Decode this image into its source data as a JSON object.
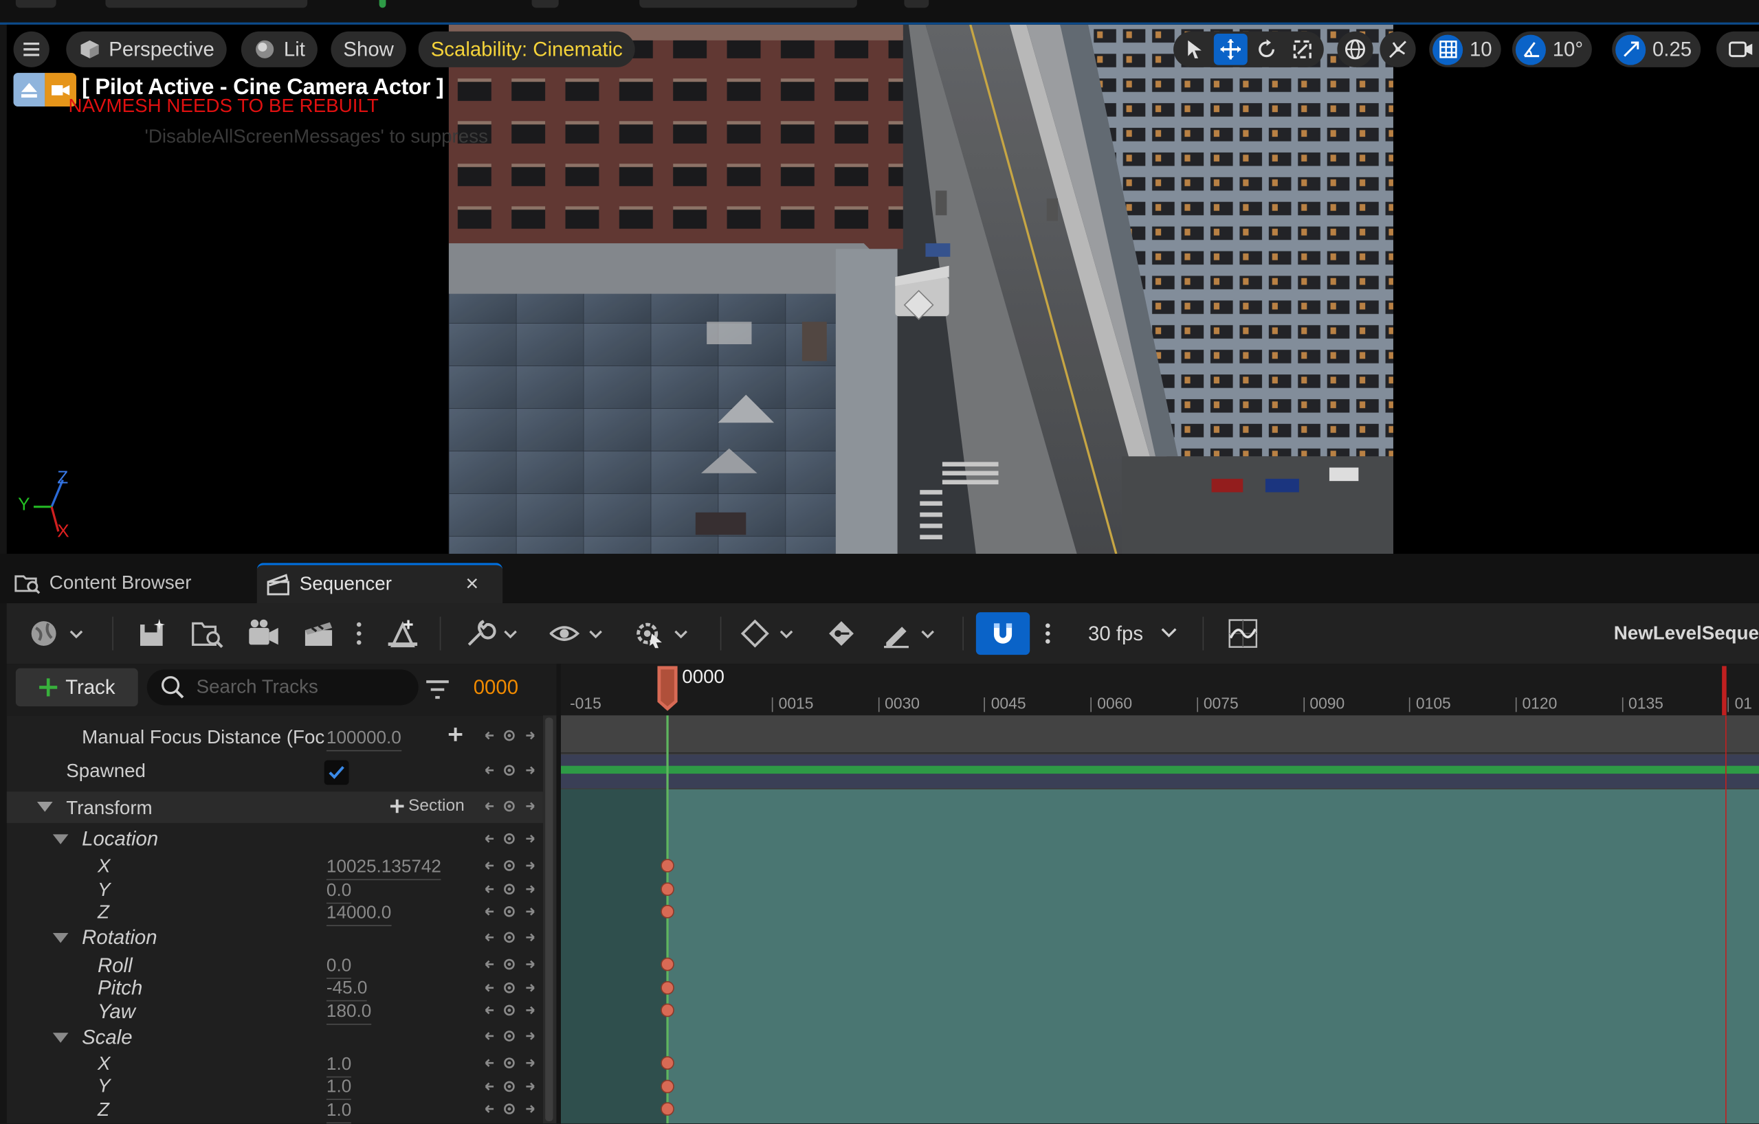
{
  "viewport": {
    "perspective_label": "Perspective",
    "lit_label": "Lit",
    "show_label": "Show",
    "scalability_label": "Scalability: Cinematic",
    "grid_snap": "10",
    "rotation_snap": "10°",
    "scale_snap": "0.25",
    "pilot_label": "[ Pilot Active - Cine Camera Actor ]",
    "navmesh_warning": "NAVMESH NEEDS TO BE REBUILT",
    "disable_messages": "'DisableAllScreenMessages' to suppress",
    "axis_z": "Z",
    "axis_y": "Y",
    "axis_x": "X"
  },
  "tabs": {
    "content_browser": "Content Browser",
    "sequencer": "Sequencer",
    "close": "×"
  },
  "sequencer": {
    "fps": "30 fps",
    "sequence_name": "NewLevelSeque",
    "add_track_label": "Track",
    "search_placeholder": "Search Tracks",
    "current_frame": "0000",
    "playhead_frame": "0000",
    "ruler_ticks": [
      "-015",
      "0015",
      "0030",
      "0045",
      "0060",
      "0075",
      "0090",
      "0105",
      "0120",
      "0135",
      "01"
    ],
    "tracks": {
      "manual_focus_label": "Manual Focus Distance (Foc",
      "manual_focus_value": "100000.0",
      "spawned_label": "Spawned",
      "spawned_checked": true,
      "transform_label": "Transform",
      "section_label": "Section",
      "location_label": "Location",
      "location_x_label": "X",
      "location_x": "10025.135742",
      "location_y_label": "Y",
      "location_y": "0.0",
      "location_z_label": "Z",
      "location_z": "14000.0",
      "rotation_label": "Rotation",
      "roll_label": "Roll",
      "roll": "0.0",
      "pitch_label": "Pitch",
      "pitch": "-45.0",
      "yaw_label": "Yaw",
      "yaw": "180.0",
      "scale_label": "Scale",
      "scale_x_label": "X",
      "scale_x": "1.0",
      "scale_y_label": "Y",
      "scale_y": "1.0",
      "scale_z_label": "Z",
      "scale_z": "1.0"
    }
  },
  "colors": {
    "accent_blue": "#0a63c8",
    "scalability_text": "#f5d33a",
    "frame_orange": "#f08a00",
    "navmesh_red": "#e01010",
    "section_teal": "#4a7672",
    "spawned_green": "#2e9a46"
  }
}
